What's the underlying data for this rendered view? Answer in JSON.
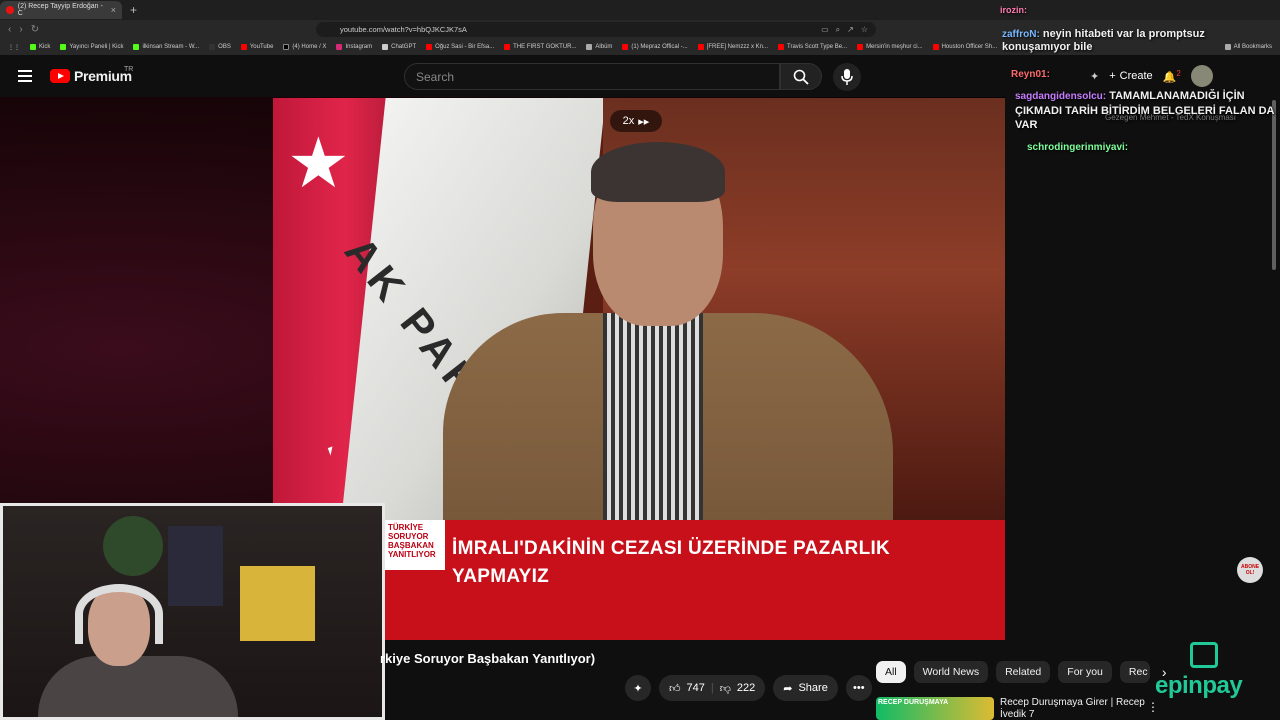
{
  "browser": {
    "tab_title": "(2) Recep Tayyip Erdoğan - C",
    "new_tab": "+",
    "url": "youtube.com/watch?v=hbQJKCJK7sA",
    "bookmarks": [
      "Kick",
      "Yayıncı Paneli | Kick",
      "ilkinsan Stream - W...",
      "OBS",
      "YouTube",
      "(4) Home / X",
      "Instagram",
      "ChatGPT",
      "Oğuz Sasi - Bir Efsa...",
      "THE FIRST GOKTUR...",
      "Albüm",
      "(1) Mepraz Offical -...",
      "[FREE] Nemzzz x Kn...",
      "Travis Scott Type Be...",
      "Mersin'in meşhur ci...",
      "Houston Officer Sh..."
    ],
    "all_bookmarks": "All Bookmarks"
  },
  "youtube": {
    "logo_text": "Premium",
    "country": "TR",
    "search_placeholder": "Search",
    "create_label": "Create",
    "notif_count": "2",
    "speed_label": "2x",
    "caption_line1": "İMRALI'DAKİNİN CEZASI ÜZERİNDE PAZARLIK",
    "caption_line2": "YAPMAYIZ",
    "lower_side": "TÜRKİYE SORUYOR BAŞBAKAN YANITLIYOR",
    "video_title": "rkiye Soruyor Başbakan Yanıtlıyor)",
    "likes": "747",
    "dislikes": "222",
    "share_label": "Share",
    "chips": [
      "All",
      "World News",
      "Related",
      "For you",
      "Rec"
    ],
    "rec_title": "Recep Duruşmaya Girer | Recep İvedik 7",
    "rec_thumb_text": "RECEP DURUŞMAYA",
    "overlay_talk": "Gezegen Mehmet - TedX Konuşması",
    "abone": "ABONE OL!"
  },
  "chat": [
    {
      "user": "irozin:",
      "text": "",
      "color": "#ff7ab0"
    },
    {
      "user": "zaffroN:",
      "text": "neyin hitabeti var la promptsuz konuşamıyor bile",
      "color": "#7ab8ff"
    },
    {
      "user": "Reyn01:",
      "text": "",
      "color": "#ff6b6b"
    },
    {
      "user": "sagdangidensolcu:",
      "text": "TAMAMLANAMADIĞI İÇİN ÇIKMADI TARİH BİTİRDİM BELGELERİ FALAN DA VAR",
      "color": "#c77dff"
    },
    {
      "user": "schrodingerinmiyavi:",
      "text": "",
      "color": "#7dff9b"
    }
  ],
  "sponsor": "epinpay"
}
